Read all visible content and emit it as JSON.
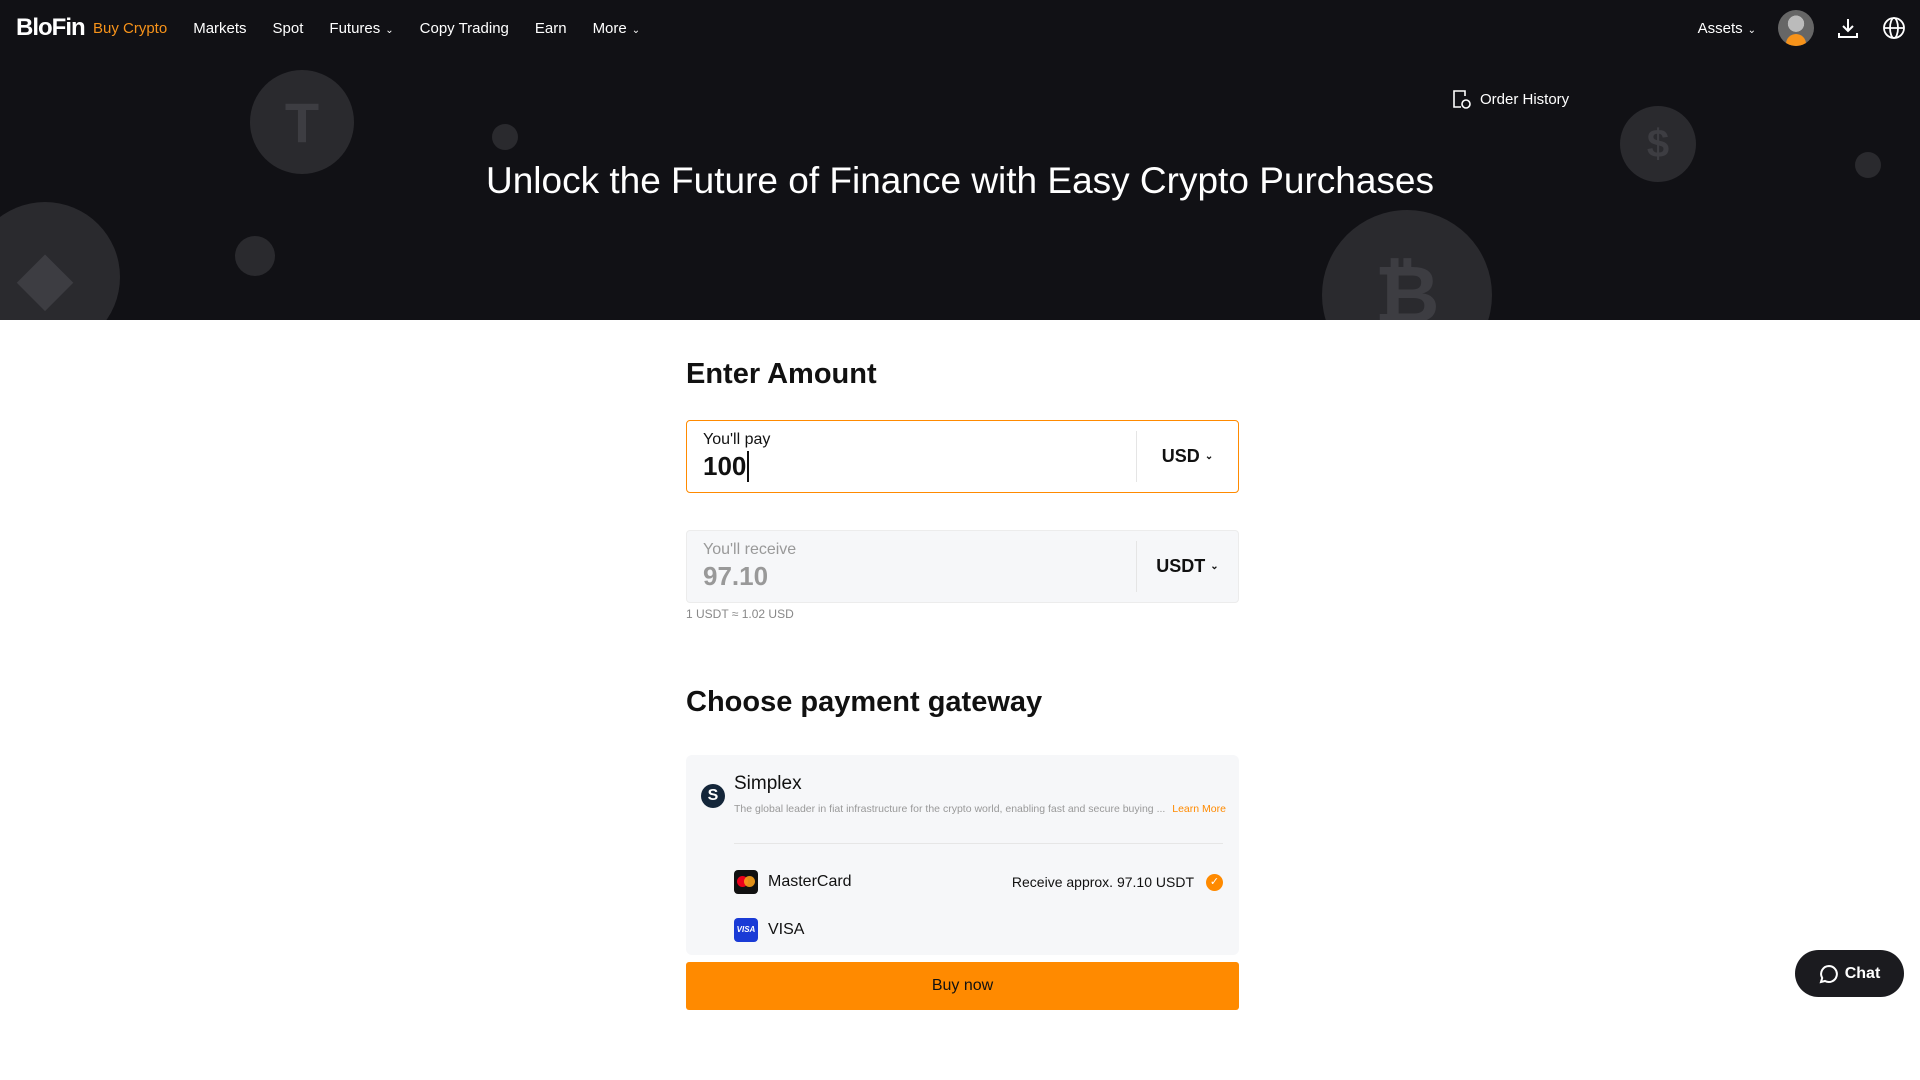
{
  "nav": {
    "logo": "BloFin",
    "items": [
      {
        "label": "Buy Crypto",
        "active": true
      },
      {
        "label": "Markets"
      },
      {
        "label": "Spot"
      },
      {
        "label": "Futures",
        "dropdown": true
      },
      {
        "label": "Copy Trading"
      },
      {
        "label": "Earn"
      },
      {
        "label": "More",
        "dropdown": true
      }
    ],
    "assets": "Assets"
  },
  "hero": {
    "title": "Unlock the Future of Finance with Easy Crypto Purchases",
    "order_history": "Order History"
  },
  "amount": {
    "heading": "Enter Amount",
    "pay_label": "You'll pay",
    "pay_value": "100",
    "pay_currency": "USD",
    "receive_label": "You'll receive",
    "receive_value": "97.10",
    "receive_currency": "USDT",
    "rate": "1 USDT ≈ 1.02 USD"
  },
  "gateway": {
    "heading": "Choose payment gateway",
    "provider": "Simplex",
    "description": "The global leader in fiat infrastructure for the crypto world, enabling fast and secure buying ...",
    "learn_more": "Learn More",
    "methods": [
      {
        "name": "MasterCard",
        "receive": "Receive approx. 97.10 USDT",
        "selected": true
      },
      {
        "name": "VISA"
      }
    ],
    "visa_logo": "VISA"
  },
  "buy_label": "Buy now",
  "chat_label": "Chat",
  "colors": {
    "accent": "#ff8a00",
    "dark": "#111115"
  }
}
